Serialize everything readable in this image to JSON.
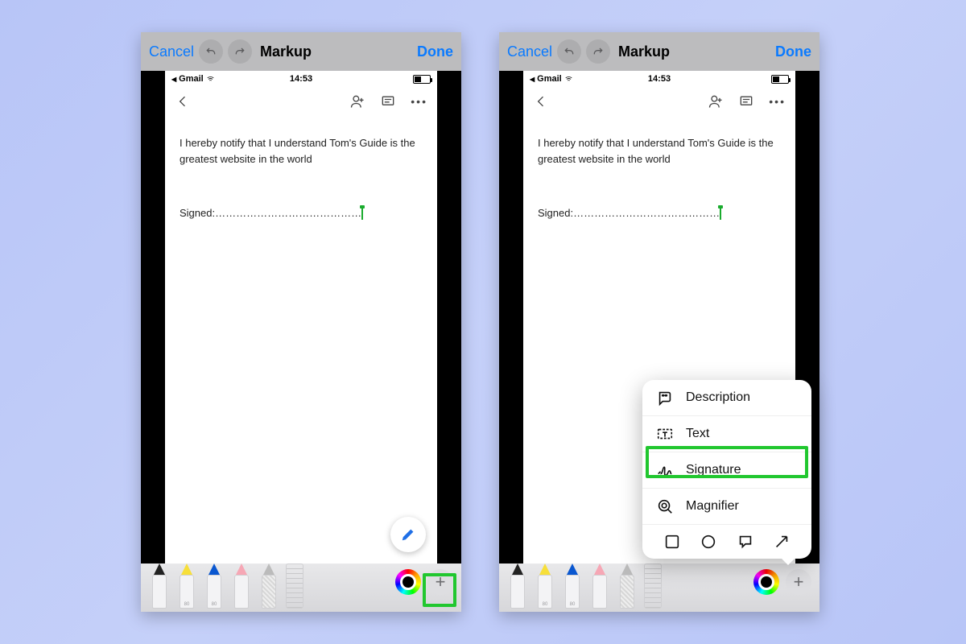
{
  "markup_bar": {
    "cancel": "Cancel",
    "title": "Markup",
    "done": "Done"
  },
  "status": {
    "back_app": "Gmail",
    "time": "14:53"
  },
  "document": {
    "body_text": "I hereby notify that I understand Tom's Guide is the greatest website in the world",
    "signed_label": "Signed:",
    "signed_dots": "……………………………………"
  },
  "tool_labels": {
    "hl": "80",
    "pencil": "80"
  },
  "popover": {
    "description": "Description",
    "text": "Text",
    "signature": "Signature",
    "magnifier": "Magnifier"
  }
}
